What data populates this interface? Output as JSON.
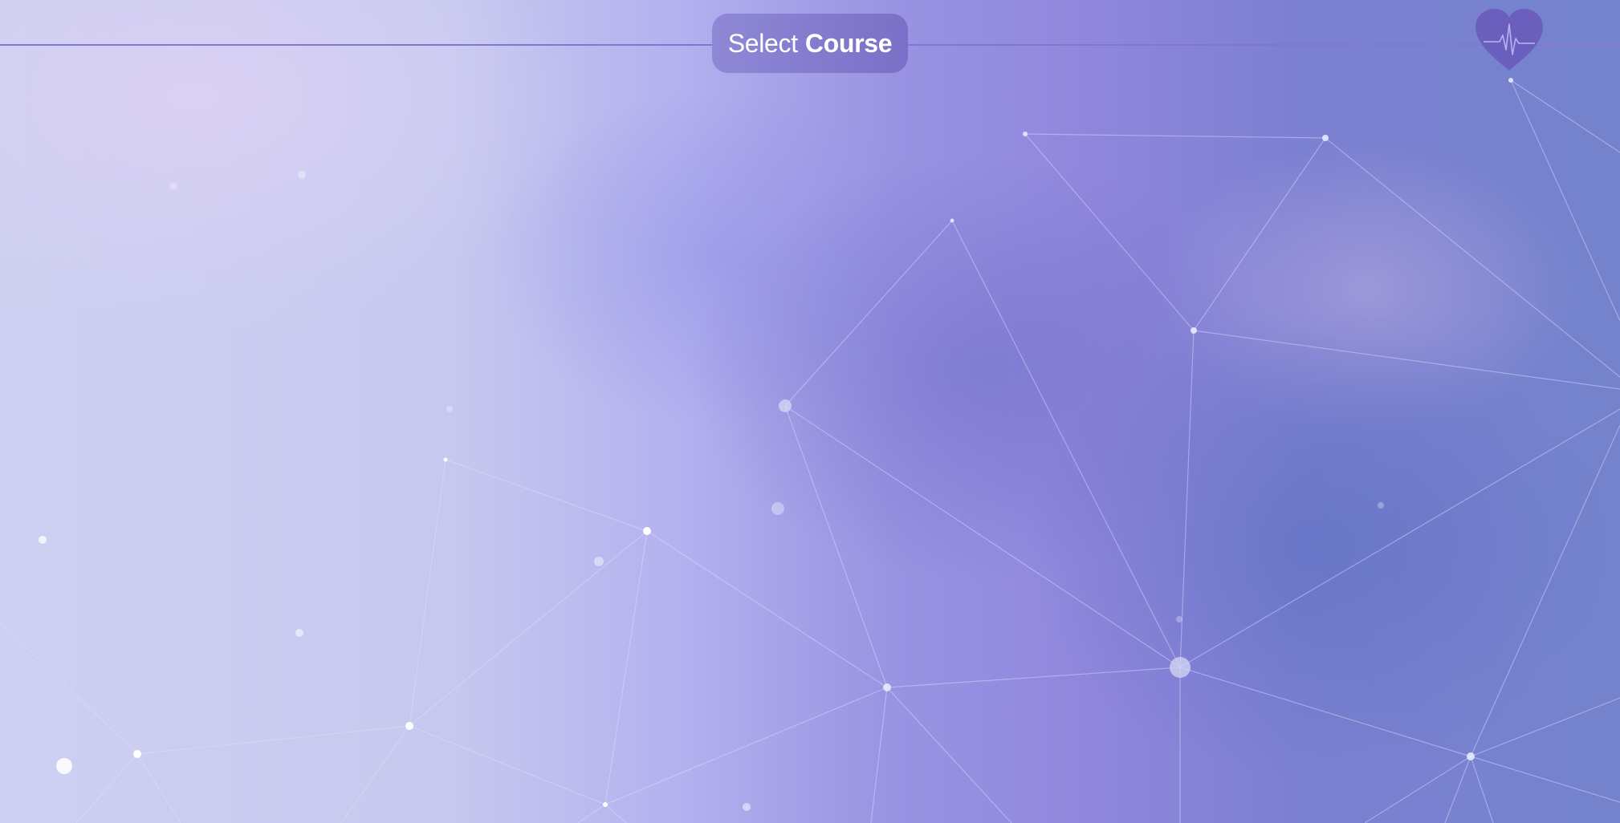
{
  "header": {
    "title_prefix": "Select",
    "title_emphasis": "Course"
  },
  "icons": {
    "logo": "heart-pulse-icon"
  },
  "colors": {
    "accent": "#7a70c7",
    "line": "#7f78cc",
    "logo": "#6a5fbd"
  }
}
